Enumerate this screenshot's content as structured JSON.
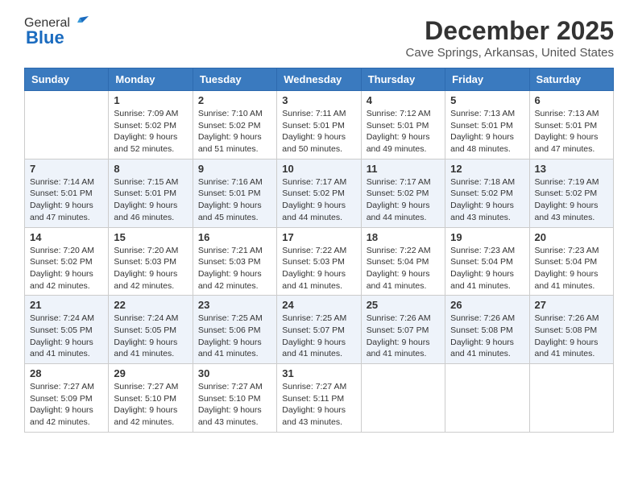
{
  "header": {
    "logo_general": "General",
    "logo_blue": "Blue",
    "month_title": "December 2025",
    "location": "Cave Springs, Arkansas, United States"
  },
  "weekdays": [
    "Sunday",
    "Monday",
    "Tuesday",
    "Wednesday",
    "Thursday",
    "Friday",
    "Saturday"
  ],
  "weeks": [
    [
      {
        "day": "",
        "sunrise": "",
        "sunset": "",
        "daylight": ""
      },
      {
        "day": "1",
        "sunrise": "Sunrise: 7:09 AM",
        "sunset": "Sunset: 5:02 PM",
        "daylight": "Daylight: 9 hours and 52 minutes."
      },
      {
        "day": "2",
        "sunrise": "Sunrise: 7:10 AM",
        "sunset": "Sunset: 5:02 PM",
        "daylight": "Daylight: 9 hours and 51 minutes."
      },
      {
        "day": "3",
        "sunrise": "Sunrise: 7:11 AM",
        "sunset": "Sunset: 5:01 PM",
        "daylight": "Daylight: 9 hours and 50 minutes."
      },
      {
        "day": "4",
        "sunrise": "Sunrise: 7:12 AM",
        "sunset": "Sunset: 5:01 PM",
        "daylight": "Daylight: 9 hours and 49 minutes."
      },
      {
        "day": "5",
        "sunrise": "Sunrise: 7:13 AM",
        "sunset": "Sunset: 5:01 PM",
        "daylight": "Daylight: 9 hours and 48 minutes."
      },
      {
        "day": "6",
        "sunrise": "Sunrise: 7:13 AM",
        "sunset": "Sunset: 5:01 PM",
        "daylight": "Daylight: 9 hours and 47 minutes."
      }
    ],
    [
      {
        "day": "7",
        "sunrise": "Sunrise: 7:14 AM",
        "sunset": "Sunset: 5:01 PM",
        "daylight": "Daylight: 9 hours and 47 minutes."
      },
      {
        "day": "8",
        "sunrise": "Sunrise: 7:15 AM",
        "sunset": "Sunset: 5:01 PM",
        "daylight": "Daylight: 9 hours and 46 minutes."
      },
      {
        "day": "9",
        "sunrise": "Sunrise: 7:16 AM",
        "sunset": "Sunset: 5:01 PM",
        "daylight": "Daylight: 9 hours and 45 minutes."
      },
      {
        "day": "10",
        "sunrise": "Sunrise: 7:17 AM",
        "sunset": "Sunset: 5:02 PM",
        "daylight": "Daylight: 9 hours and 44 minutes."
      },
      {
        "day": "11",
        "sunrise": "Sunrise: 7:17 AM",
        "sunset": "Sunset: 5:02 PM",
        "daylight": "Daylight: 9 hours and 44 minutes."
      },
      {
        "day": "12",
        "sunrise": "Sunrise: 7:18 AM",
        "sunset": "Sunset: 5:02 PM",
        "daylight": "Daylight: 9 hours and 43 minutes."
      },
      {
        "day": "13",
        "sunrise": "Sunrise: 7:19 AM",
        "sunset": "Sunset: 5:02 PM",
        "daylight": "Daylight: 9 hours and 43 minutes."
      }
    ],
    [
      {
        "day": "14",
        "sunrise": "Sunrise: 7:20 AM",
        "sunset": "Sunset: 5:02 PM",
        "daylight": "Daylight: 9 hours and 42 minutes."
      },
      {
        "day": "15",
        "sunrise": "Sunrise: 7:20 AM",
        "sunset": "Sunset: 5:03 PM",
        "daylight": "Daylight: 9 hours and 42 minutes."
      },
      {
        "day": "16",
        "sunrise": "Sunrise: 7:21 AM",
        "sunset": "Sunset: 5:03 PM",
        "daylight": "Daylight: 9 hours and 42 minutes."
      },
      {
        "day": "17",
        "sunrise": "Sunrise: 7:22 AM",
        "sunset": "Sunset: 5:03 PM",
        "daylight": "Daylight: 9 hours and 41 minutes."
      },
      {
        "day": "18",
        "sunrise": "Sunrise: 7:22 AM",
        "sunset": "Sunset: 5:04 PM",
        "daylight": "Daylight: 9 hours and 41 minutes."
      },
      {
        "day": "19",
        "sunrise": "Sunrise: 7:23 AM",
        "sunset": "Sunset: 5:04 PM",
        "daylight": "Daylight: 9 hours and 41 minutes."
      },
      {
        "day": "20",
        "sunrise": "Sunrise: 7:23 AM",
        "sunset": "Sunset: 5:04 PM",
        "daylight": "Daylight: 9 hours and 41 minutes."
      }
    ],
    [
      {
        "day": "21",
        "sunrise": "Sunrise: 7:24 AM",
        "sunset": "Sunset: 5:05 PM",
        "daylight": "Daylight: 9 hours and 41 minutes."
      },
      {
        "day": "22",
        "sunrise": "Sunrise: 7:24 AM",
        "sunset": "Sunset: 5:05 PM",
        "daylight": "Daylight: 9 hours and 41 minutes."
      },
      {
        "day": "23",
        "sunrise": "Sunrise: 7:25 AM",
        "sunset": "Sunset: 5:06 PM",
        "daylight": "Daylight: 9 hours and 41 minutes."
      },
      {
        "day": "24",
        "sunrise": "Sunrise: 7:25 AM",
        "sunset": "Sunset: 5:07 PM",
        "daylight": "Daylight: 9 hours and 41 minutes."
      },
      {
        "day": "25",
        "sunrise": "Sunrise: 7:26 AM",
        "sunset": "Sunset: 5:07 PM",
        "daylight": "Daylight: 9 hours and 41 minutes."
      },
      {
        "day": "26",
        "sunrise": "Sunrise: 7:26 AM",
        "sunset": "Sunset: 5:08 PM",
        "daylight": "Daylight: 9 hours and 41 minutes."
      },
      {
        "day": "27",
        "sunrise": "Sunrise: 7:26 AM",
        "sunset": "Sunset: 5:08 PM",
        "daylight": "Daylight: 9 hours and 41 minutes."
      }
    ],
    [
      {
        "day": "28",
        "sunrise": "Sunrise: 7:27 AM",
        "sunset": "Sunset: 5:09 PM",
        "daylight": "Daylight: 9 hours and 42 minutes."
      },
      {
        "day": "29",
        "sunrise": "Sunrise: 7:27 AM",
        "sunset": "Sunset: 5:10 PM",
        "daylight": "Daylight: 9 hours and 42 minutes."
      },
      {
        "day": "30",
        "sunrise": "Sunrise: 7:27 AM",
        "sunset": "Sunset: 5:10 PM",
        "daylight": "Daylight: 9 hours and 43 minutes."
      },
      {
        "day": "31",
        "sunrise": "Sunrise: 7:27 AM",
        "sunset": "Sunset: 5:11 PM",
        "daylight": "Daylight: 9 hours and 43 minutes."
      },
      {
        "day": "",
        "sunrise": "",
        "sunset": "",
        "daylight": ""
      },
      {
        "day": "",
        "sunrise": "",
        "sunset": "",
        "daylight": ""
      },
      {
        "day": "",
        "sunrise": "",
        "sunset": "",
        "daylight": ""
      }
    ]
  ]
}
